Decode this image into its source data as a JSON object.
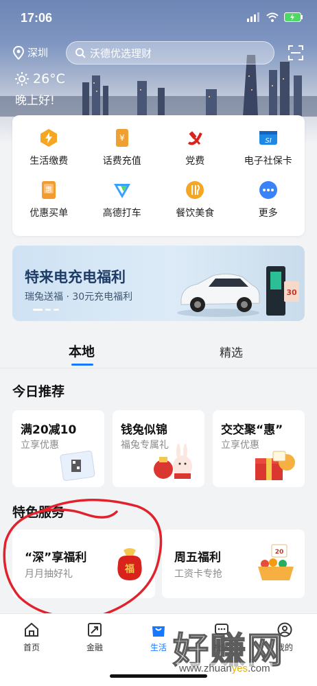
{
  "status": {
    "time": "17:06"
  },
  "header": {
    "location": "深圳",
    "search_placeholder": "沃德优选理财",
    "temperature": "26°C",
    "greeting": "晚上好!"
  },
  "services": [
    {
      "label": "生活缴费",
      "icon": "lightning-icon",
      "color": "#f5a623"
    },
    {
      "label": "话费充值",
      "icon": "yen-card-icon",
      "color": "#f0a030"
    },
    {
      "label": "党费",
      "icon": "party-emblem-icon",
      "color": "#d9221b"
    },
    {
      "label": "电子社保卡",
      "icon": "si-card-icon",
      "color": "#1e88e5"
    },
    {
      "label": "优惠买单",
      "icon": "discount-icon",
      "color": "#f29b2f"
    },
    {
      "label": "高德打车",
      "icon": "gaode-icon",
      "color": "#3aa0ff"
    },
    {
      "label": "餐饮美食",
      "icon": "food-icon",
      "color": "#f5a623"
    },
    {
      "label": "更多",
      "icon": "more-icon",
      "color": "#3a82f7"
    }
  ],
  "banner": {
    "title": "特来电充电福利",
    "subtitle": "瑞兔送福 · 30元充电福利",
    "badge": "30"
  },
  "tabs": {
    "active": "本地",
    "other": "精选"
  },
  "today": {
    "title": "今日推荐",
    "cards": [
      {
        "title": "满20减10",
        "subtitle": "立享优惠"
      },
      {
        "title": "钱兔似锦",
        "subtitle": "福兔专属礼"
      },
      {
        "title": "交交聚“惠”",
        "subtitle": "立享优惠"
      }
    ]
  },
  "featured": {
    "title": "特色服务",
    "cards": [
      {
        "title": "“深”享福利",
        "subtitle": "月月抽好礼",
        "art_text": "福"
      },
      {
        "title": "周五福利",
        "subtitle": "工资卡专抢",
        "art_text": "20"
      }
    ]
  },
  "nav": [
    {
      "label": "首页",
      "icon": "home-icon",
      "active": false
    },
    {
      "label": "金融",
      "icon": "finance-icon",
      "active": false
    },
    {
      "label": "生活",
      "icon": "life-bag-icon",
      "active": true
    },
    {
      "label": "社区",
      "icon": "chat-icon",
      "active": false
    },
    {
      "label": "我的",
      "icon": "profile-icon",
      "active": false
    }
  ],
  "watermark": {
    "text": "好赚网",
    "url_a": "www.zhuan",
    "url_y": "yes",
    "url_b": ".com"
  },
  "colors": {
    "accent": "#1677ff",
    "annotation": "#e1222c"
  }
}
